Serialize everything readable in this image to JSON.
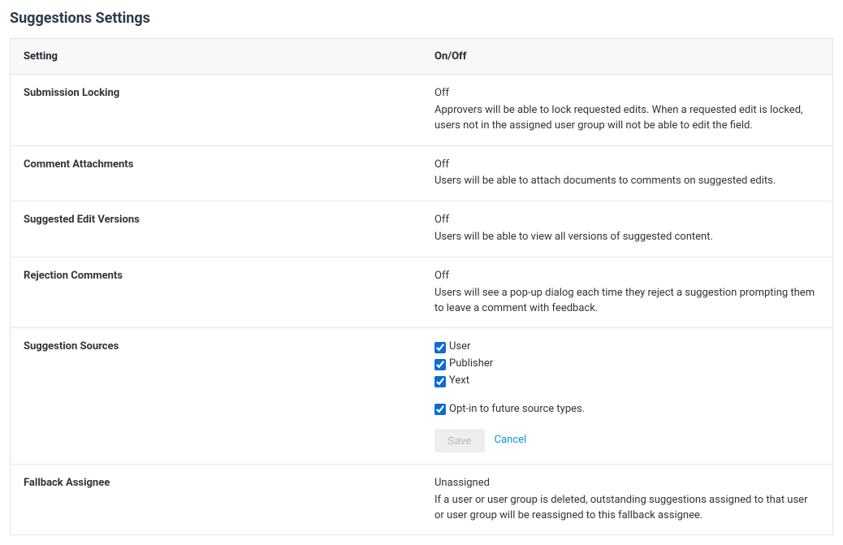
{
  "title": "Suggestions Settings",
  "columns": {
    "setting": "Setting",
    "onoff": "On/Off"
  },
  "rows": {
    "submission_locking": {
      "name": "Submission Locking",
      "status": "Off",
      "desc": "Approvers will be able to lock requested edits. When a requested edit is locked, users not in the assigned user group will not be able to edit the field."
    },
    "comment_attachments": {
      "name": "Comment Attachments",
      "status": "Off",
      "desc": "Users will be able to attach documents to comments on suggested edits."
    },
    "suggested_edit_versions": {
      "name": "Suggested Edit Versions",
      "status": "Off",
      "desc": "Users will be able to view all versions of suggested content."
    },
    "rejection_comments": {
      "name": "Rejection Comments",
      "status": "Off",
      "desc": "Users will see a pop-up dialog each time they reject a suggestion prompting them to leave a comment with feedback."
    },
    "suggestion_sources": {
      "name": "Suggestion Sources",
      "options": {
        "user": {
          "label": "User",
          "checked": true
        },
        "publisher": {
          "label": "Publisher",
          "checked": true
        },
        "yext": {
          "label": "Yext",
          "checked": true
        }
      },
      "optin": {
        "label": "Opt-in to future source types.",
        "checked": true
      },
      "save_label": "Save",
      "cancel_label": "Cancel"
    },
    "fallback_assignee": {
      "name": "Fallback Assignee",
      "status": "Unassigned",
      "desc": "If a user or user group is deleted, outstanding suggestions assigned to that user or user group will be reassigned to this fallback assignee."
    }
  }
}
